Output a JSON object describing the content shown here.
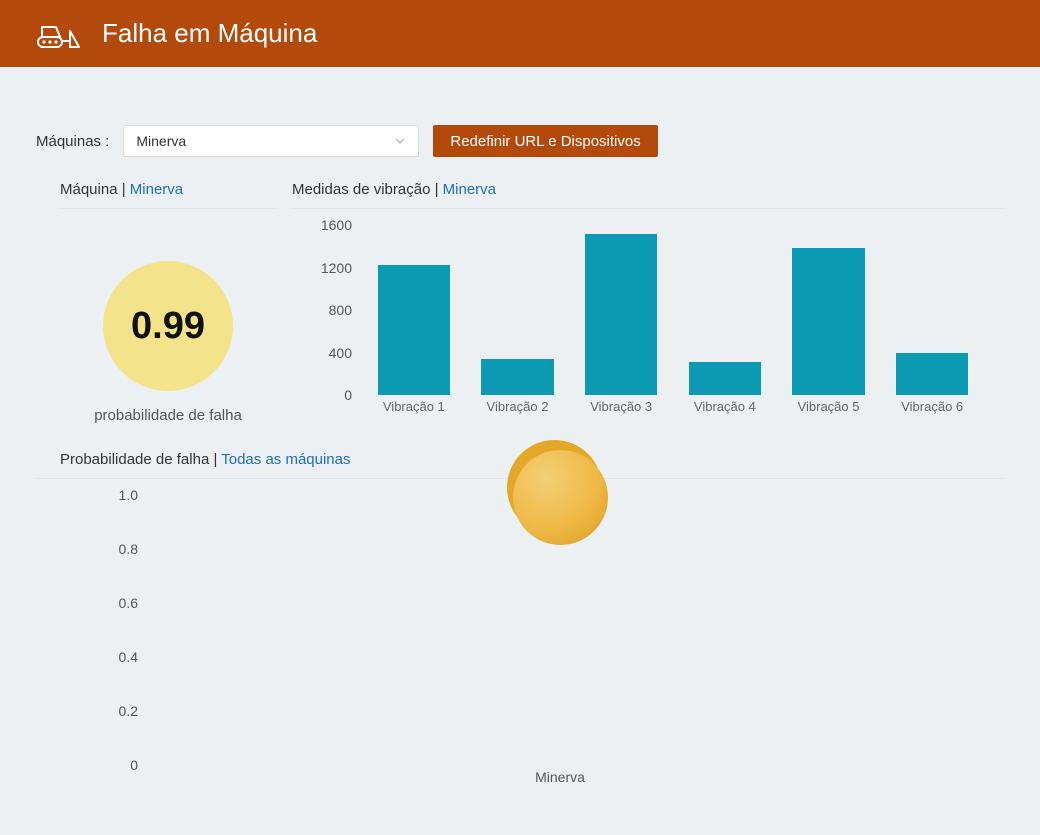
{
  "header": {
    "title": "Falha em Máquina"
  },
  "filter": {
    "label": "Máquinas :",
    "selected": "Minerva",
    "reset_button": "Redefinir URL e Dispositivos"
  },
  "machine_panel": {
    "title_prefix": "Máquina | ",
    "title_accent": "Minerva",
    "probability_value": "0.99",
    "caption": "probabilidade de falha"
  },
  "vibration_panel": {
    "title_prefix": "Medidas de vibração | ",
    "title_accent": "Minerva"
  },
  "all_panel": {
    "title_prefix": "Probabilidade de falha | ",
    "title_accent": "Todas as máquinas"
  },
  "chart_data": [
    {
      "type": "bar",
      "title": "Medidas de vibração | Minerva",
      "categories": [
        "Vibração 1",
        "Vibração 2",
        "Vibração 3",
        "Vibração 4",
        "Vibração 5",
        "Vibração 6"
      ],
      "values": [
        1220,
        340,
        1520,
        310,
        1380,
        400
      ],
      "ylabel": "",
      "xlabel": "",
      "ylim": [
        0,
        1600
      ],
      "yticks": [
        0,
        400,
        800,
        1200,
        1600
      ]
    },
    {
      "type": "scatter",
      "title": "Probabilidade de falha | Todas as máquinas",
      "categories": [
        "Minerva"
      ],
      "series": [
        {
          "name": "Minerva",
          "x": 0,
          "y": 0.99,
          "size": 95
        }
      ],
      "ylim": [
        0,
        1.0
      ],
      "yticks": [
        0,
        0.2,
        0.4,
        0.6,
        0.8,
        1.0
      ]
    }
  ]
}
